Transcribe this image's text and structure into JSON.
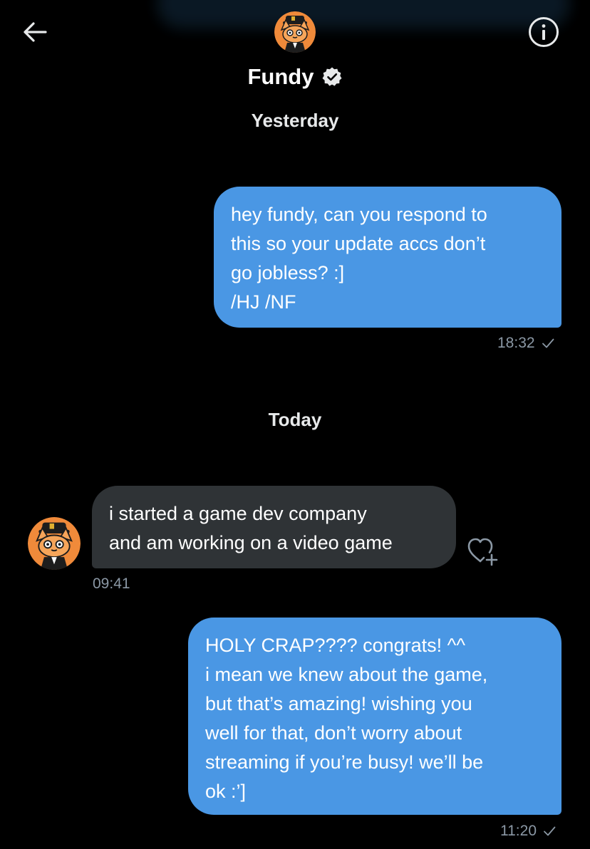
{
  "conversation": {
    "name": "Fundy",
    "verified": true
  },
  "icons": {
    "back": "arrow-left-icon",
    "info": "info-circle-icon",
    "verified": "verified-badge-icon",
    "read_receipt": "checkmark-icon",
    "react": "heart-plus-icon"
  },
  "colors": {
    "sent_bubble": "#4a97e4",
    "received_bubble": "#2f3336",
    "background": "#000000",
    "muted_text": "#8b98a5"
  },
  "day_separators": {
    "yesterday": "Yesterday",
    "today": "Today"
  },
  "messages": {
    "m1": {
      "direction": "sent",
      "lines": [
        "hey fundy, can you respond to",
        "this so your update accs don’t",
        "go jobless? :]",
        "/HJ /NF"
      ],
      "time": "18:32",
      "receipt": "✓"
    },
    "m2": {
      "direction": "received",
      "lines": [
        "i started a game dev company",
        "and am working on a video game"
      ],
      "time": "09:41"
    },
    "m3": {
      "direction": "sent",
      "lines": [
        "HOLY CRAP???? congrats! ^^",
        "i mean we knew about the game,",
        "but that’s amazing! wishing you",
        "well for that, don’t worry about",
        "streaming if you’re busy! we’ll be",
        "ok :’]"
      ],
      "time": "11:20",
      "receipt": "✓"
    }
  }
}
